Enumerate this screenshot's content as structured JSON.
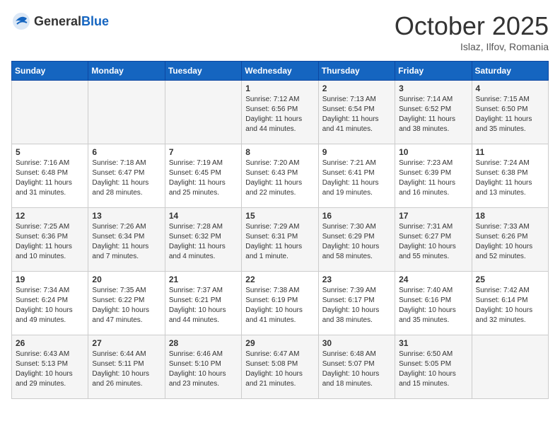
{
  "header": {
    "logo_general": "General",
    "logo_blue": "Blue",
    "month": "October 2025",
    "location": "Islaz, Ilfov, Romania"
  },
  "days_of_week": [
    "Sunday",
    "Monday",
    "Tuesday",
    "Wednesday",
    "Thursday",
    "Friday",
    "Saturday"
  ],
  "weeks": [
    [
      {
        "day": "",
        "info": ""
      },
      {
        "day": "",
        "info": ""
      },
      {
        "day": "",
        "info": ""
      },
      {
        "day": "1",
        "info": "Sunrise: 7:12 AM\nSunset: 6:56 PM\nDaylight: 11 hours and 44 minutes."
      },
      {
        "day": "2",
        "info": "Sunrise: 7:13 AM\nSunset: 6:54 PM\nDaylight: 11 hours and 41 minutes."
      },
      {
        "day": "3",
        "info": "Sunrise: 7:14 AM\nSunset: 6:52 PM\nDaylight: 11 hours and 38 minutes."
      },
      {
        "day": "4",
        "info": "Sunrise: 7:15 AM\nSunset: 6:50 PM\nDaylight: 11 hours and 35 minutes."
      }
    ],
    [
      {
        "day": "5",
        "info": "Sunrise: 7:16 AM\nSunset: 6:48 PM\nDaylight: 11 hours and 31 minutes."
      },
      {
        "day": "6",
        "info": "Sunrise: 7:18 AM\nSunset: 6:47 PM\nDaylight: 11 hours and 28 minutes."
      },
      {
        "day": "7",
        "info": "Sunrise: 7:19 AM\nSunset: 6:45 PM\nDaylight: 11 hours and 25 minutes."
      },
      {
        "day": "8",
        "info": "Sunrise: 7:20 AM\nSunset: 6:43 PM\nDaylight: 11 hours and 22 minutes."
      },
      {
        "day": "9",
        "info": "Sunrise: 7:21 AM\nSunset: 6:41 PM\nDaylight: 11 hours and 19 minutes."
      },
      {
        "day": "10",
        "info": "Sunrise: 7:23 AM\nSunset: 6:39 PM\nDaylight: 11 hours and 16 minutes."
      },
      {
        "day": "11",
        "info": "Sunrise: 7:24 AM\nSunset: 6:38 PM\nDaylight: 11 hours and 13 minutes."
      }
    ],
    [
      {
        "day": "12",
        "info": "Sunrise: 7:25 AM\nSunset: 6:36 PM\nDaylight: 11 hours and 10 minutes."
      },
      {
        "day": "13",
        "info": "Sunrise: 7:26 AM\nSunset: 6:34 PM\nDaylight: 11 hours and 7 minutes."
      },
      {
        "day": "14",
        "info": "Sunrise: 7:28 AM\nSunset: 6:32 PM\nDaylight: 11 hours and 4 minutes."
      },
      {
        "day": "15",
        "info": "Sunrise: 7:29 AM\nSunset: 6:31 PM\nDaylight: 11 hours and 1 minute."
      },
      {
        "day": "16",
        "info": "Sunrise: 7:30 AM\nSunset: 6:29 PM\nDaylight: 10 hours and 58 minutes."
      },
      {
        "day": "17",
        "info": "Sunrise: 7:31 AM\nSunset: 6:27 PM\nDaylight: 10 hours and 55 minutes."
      },
      {
        "day": "18",
        "info": "Sunrise: 7:33 AM\nSunset: 6:26 PM\nDaylight: 10 hours and 52 minutes."
      }
    ],
    [
      {
        "day": "19",
        "info": "Sunrise: 7:34 AM\nSunset: 6:24 PM\nDaylight: 10 hours and 49 minutes."
      },
      {
        "day": "20",
        "info": "Sunrise: 7:35 AM\nSunset: 6:22 PM\nDaylight: 10 hours and 47 minutes."
      },
      {
        "day": "21",
        "info": "Sunrise: 7:37 AM\nSunset: 6:21 PM\nDaylight: 10 hours and 44 minutes."
      },
      {
        "day": "22",
        "info": "Sunrise: 7:38 AM\nSunset: 6:19 PM\nDaylight: 10 hours and 41 minutes."
      },
      {
        "day": "23",
        "info": "Sunrise: 7:39 AM\nSunset: 6:17 PM\nDaylight: 10 hours and 38 minutes."
      },
      {
        "day": "24",
        "info": "Sunrise: 7:40 AM\nSunset: 6:16 PM\nDaylight: 10 hours and 35 minutes."
      },
      {
        "day": "25",
        "info": "Sunrise: 7:42 AM\nSunset: 6:14 PM\nDaylight: 10 hours and 32 minutes."
      }
    ],
    [
      {
        "day": "26",
        "info": "Sunrise: 6:43 AM\nSunset: 5:13 PM\nDaylight: 10 hours and 29 minutes."
      },
      {
        "day": "27",
        "info": "Sunrise: 6:44 AM\nSunset: 5:11 PM\nDaylight: 10 hours and 26 minutes."
      },
      {
        "day": "28",
        "info": "Sunrise: 6:46 AM\nSunset: 5:10 PM\nDaylight: 10 hours and 23 minutes."
      },
      {
        "day": "29",
        "info": "Sunrise: 6:47 AM\nSunset: 5:08 PM\nDaylight: 10 hours and 21 minutes."
      },
      {
        "day": "30",
        "info": "Sunrise: 6:48 AM\nSunset: 5:07 PM\nDaylight: 10 hours and 18 minutes."
      },
      {
        "day": "31",
        "info": "Sunrise: 6:50 AM\nSunset: 5:05 PM\nDaylight: 10 hours and 15 minutes."
      },
      {
        "day": "",
        "info": ""
      }
    ]
  ]
}
